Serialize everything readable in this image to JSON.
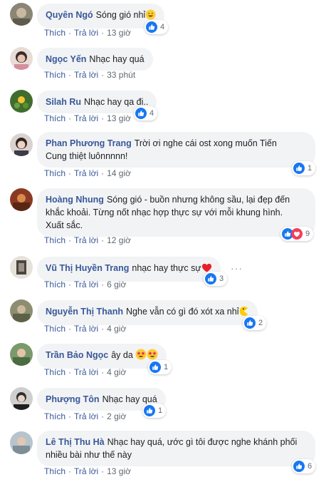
{
  "actions": {
    "like_label": "Thích",
    "reply_label": "Trả lời",
    "separator": "·"
  },
  "colors": {
    "name": "#385898",
    "bubble": "#f2f3f5",
    "like_blue": "#1877f2",
    "love_red": "#f33e58"
  },
  "comments": [
    {
      "name": "Quyên Ngó",
      "text": "Sóng gió nhỉ",
      "emoji": "grinning-face",
      "time": "13 giờ",
      "reactions": [
        "like"
      ],
      "count": "4"
    },
    {
      "name": "Ngọc Yến",
      "text": "Nhạc hay quá",
      "time": "33 phút"
    },
    {
      "name": "Silah Ru",
      "text": "Nhạc hay qa đi..",
      "time": "13 giờ",
      "reactions": [
        "like"
      ],
      "count": "4"
    },
    {
      "name": "Phan Phương Trang",
      "text_line1": "Trời ơi nghe cái ost xong muốn Tiến",
      "text_line2": "Cung thiệt luônnnnn!",
      "time": "14 giờ",
      "reactions": [
        "like"
      ],
      "count": "1"
    },
    {
      "name": "Hoàng Nhung",
      "text_line1": "Sóng gió - buồn nhưng không sầu, lại đẹp đến",
      "text_line2": "khắc khoải. Từng nốt nhạc hợp thực sự với mỗi khung hình.",
      "text_line3": "Xuất sắc.",
      "time": "12 giờ",
      "reactions": [
        "like",
        "love"
      ],
      "count": "9"
    },
    {
      "name": "Vũ Thị Huyền Trang",
      "text": "nhạc hay thực sự",
      "emoji": "red-heart",
      "time": "6 giờ",
      "reactions": [
        "like"
      ],
      "count": "3"
    },
    {
      "name": "Nguyễn Thị Thanh",
      "text": "Nghe vẫn có gì đó xót xa nhỉ",
      "emoji": "pacman",
      "time": "4 giờ",
      "reactions": [
        "like"
      ],
      "count": "2"
    },
    {
      "name": "Trần Bảo Ngọc",
      "text": "ây da",
      "emoji": "star-struck x2",
      "time": "4 giờ",
      "reactions": [
        "like"
      ],
      "count": "1"
    },
    {
      "name": "Phượng Tôn",
      "text": "Nhạc hay quá",
      "time": "2 giờ",
      "reactions": [
        "like"
      ],
      "count": "1"
    },
    {
      "name": "Lê Thị Thu Hà",
      "text_line1": "Nhạc hay quá, ước gì tôi được nghe khánh phối",
      "text_line2": "nhiều bài như thế này",
      "time": "13 giờ",
      "reactions": [
        "like"
      ],
      "count": "6"
    }
  ]
}
